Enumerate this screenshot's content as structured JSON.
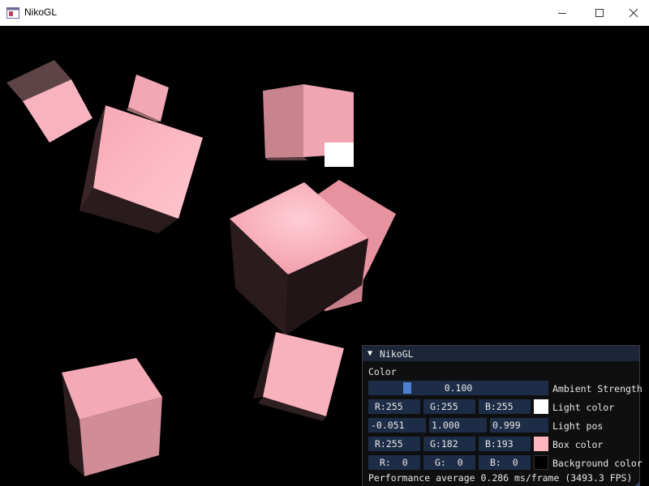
{
  "window": {
    "title": "NikoGL",
    "icons": [
      "app-icon",
      "minimize-icon",
      "maximize-icon",
      "close-icon"
    ]
  },
  "imgui": {
    "title": "NikoGL",
    "section_label": "Color",
    "ambient": {
      "value_text": "0.100",
      "fraction": 0.1,
      "label": "Ambient Strength"
    },
    "light_color": {
      "r": "R:255",
      "g": "G:255",
      "b": "B:255",
      "swatch": "#ffffff",
      "label": "Light color"
    },
    "light_pos": {
      "x": "-0.051",
      "y": "1.000",
      "z": "0.999",
      "label": "Light pos"
    },
    "box_color": {
      "r": "R:255",
      "g": "G:182",
      "b": "B:193",
      "swatch": "#ffb6c1",
      "label": "Box color"
    },
    "background_color": {
      "r": "R:  0",
      "g": "G:  0",
      "b": "B:  0",
      "swatch": "#000000",
      "label": "Background color"
    },
    "performance": "Performance average 0.286 ms/frame (3493.3 FPS)"
  },
  "colors": {
    "box": "#ffb6c1",
    "light": "#ffffff",
    "background": "#000000"
  }
}
